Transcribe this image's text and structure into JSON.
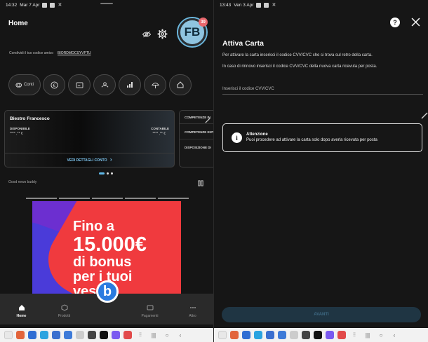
{
  "left": {
    "status": {
      "time": "14:32",
      "date": "Mar 7 Apr"
    },
    "header": {
      "title": "Home",
      "avatar_initials": "FB",
      "notification_count": "39"
    },
    "friend": {
      "label": "Condividi il tuo codice amico",
      "code": "BIORDMOCSYVPTU"
    },
    "quick_actions": [
      {
        "label": "Conti",
        "icon": "coins-icon"
      },
      {
        "label": "",
        "icon": "euro-icon"
      },
      {
        "label": "",
        "icon": "card-icon"
      },
      {
        "label": "",
        "icon": "savings-icon"
      },
      {
        "label": "",
        "icon": "chart-icon"
      },
      {
        "label": "",
        "icon": "umbrella-icon"
      },
      {
        "label": "",
        "icon": "house-icon"
      }
    ],
    "account_card": {
      "name": "Biestro Francesco",
      "available_label": "DISPONIBILE",
      "available_value": "**** ,** €",
      "accounting_label": "CONTABILE",
      "accounting_value": "**** ,** €",
      "details_label": "VEDI DETTAGLI CONTO"
    },
    "side_card": {
      "items": [
        "COMPETENZE IN",
        "COMPETENZE ENT",
        "DISPOSIZIONE DI"
      ]
    },
    "news_label": "Good news buddy",
    "banner": {
      "line1": "Fino a",
      "line2": "15.000€",
      "line3": "di bonus",
      "line4": "per i tuoi",
      "line5": "vestiti"
    },
    "bottom_nav": [
      {
        "label": "Home",
        "icon": "home-icon",
        "active": true
      },
      {
        "label": "Prodotti",
        "icon": "box-icon",
        "active": false
      },
      {
        "label": "",
        "icon": "",
        "active": false
      },
      {
        "label": "Pagamenti",
        "icon": "wallet-icon",
        "active": false
      },
      {
        "label": "Altro",
        "icon": "more-icon",
        "active": false
      }
    ]
  },
  "right": {
    "status": {
      "time": "13:43",
      "date": "Ven 3 Apr"
    },
    "title": "Attiva Carta",
    "paragraph1": "Per attivare la carta inserisci il codice CVV/CVC che si trova sul retro della carta.",
    "paragraph2": "In caso di rinnovo inserisci il codice CVV/CVC della nuova carta ricevuta per posta.",
    "cvv_placeholder": "Inserisci il codice CVV/CVC",
    "alert": {
      "title": "Attenzione",
      "text": "Puoi procedere ad attivare la carta solo dopo averla ricevuta per posta"
    },
    "next_button": "AVANTI"
  },
  "colors": {
    "accent": "#5fb8e8",
    "badge": "#e8676d",
    "banner_red": "#f03a3e",
    "banner_purple": "#6c2fd0",
    "button_disabled": "#1f3543"
  }
}
